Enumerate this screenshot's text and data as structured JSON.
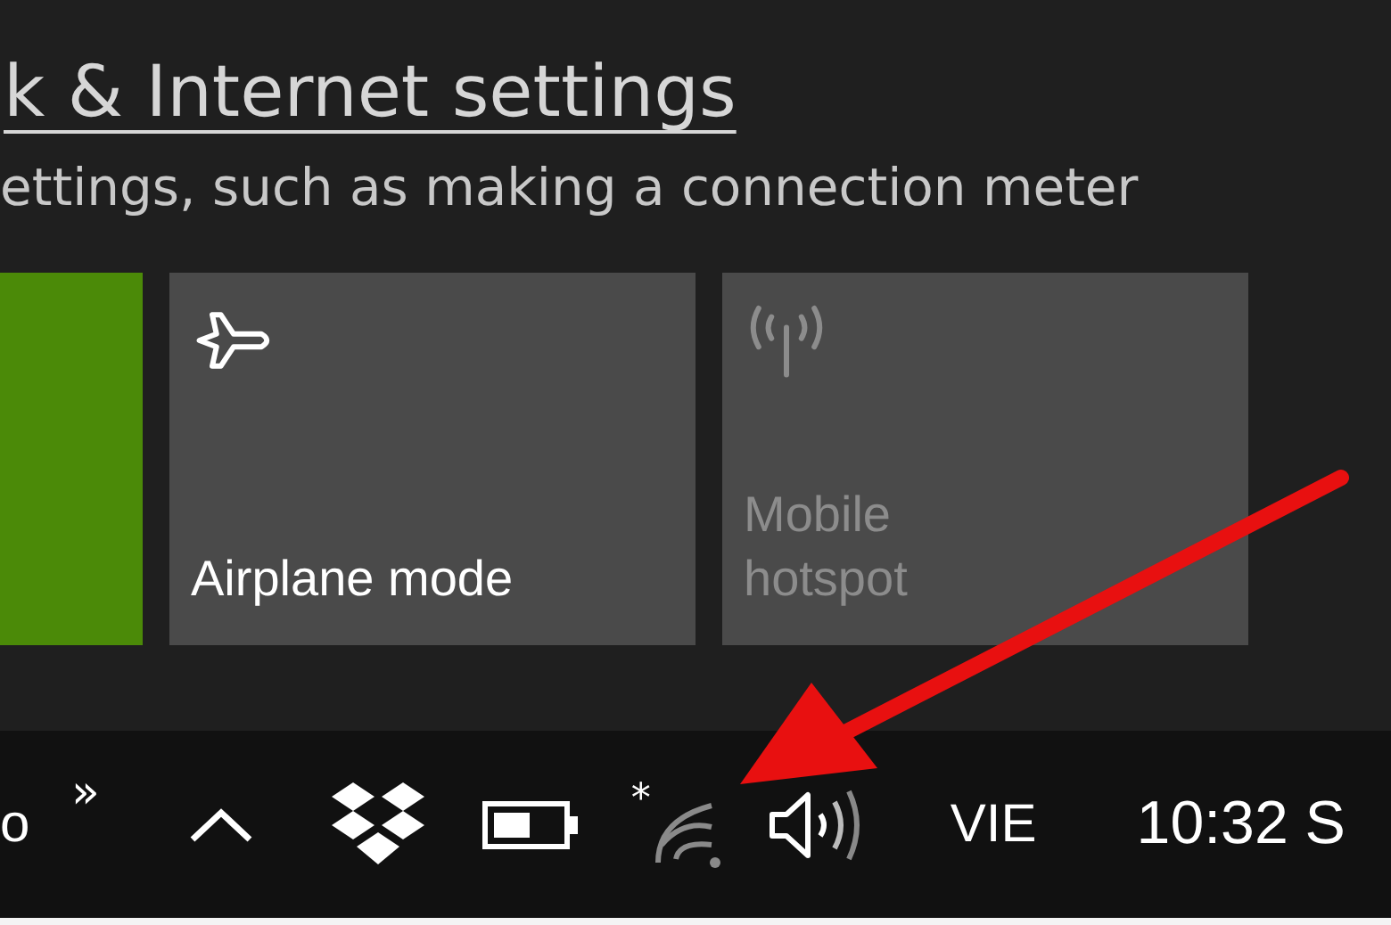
{
  "flyout": {
    "settings_link": "k & Internet settings",
    "description": "ettings, such as making a connection meter",
    "tiles": [
      {
        "kind": "partial",
        "on": true,
        "disabled": false
      },
      {
        "kind": "airplane",
        "label": "Airplane mode",
        "on": false,
        "disabled": false
      },
      {
        "kind": "hotspot",
        "label": "Mobile hotspot",
        "on": false,
        "disabled": true
      }
    ]
  },
  "taskbar": {
    "left_text": "o",
    "overflow": "»",
    "language": "VIE",
    "clock": "10:32 S",
    "wifi_badge": "*"
  }
}
